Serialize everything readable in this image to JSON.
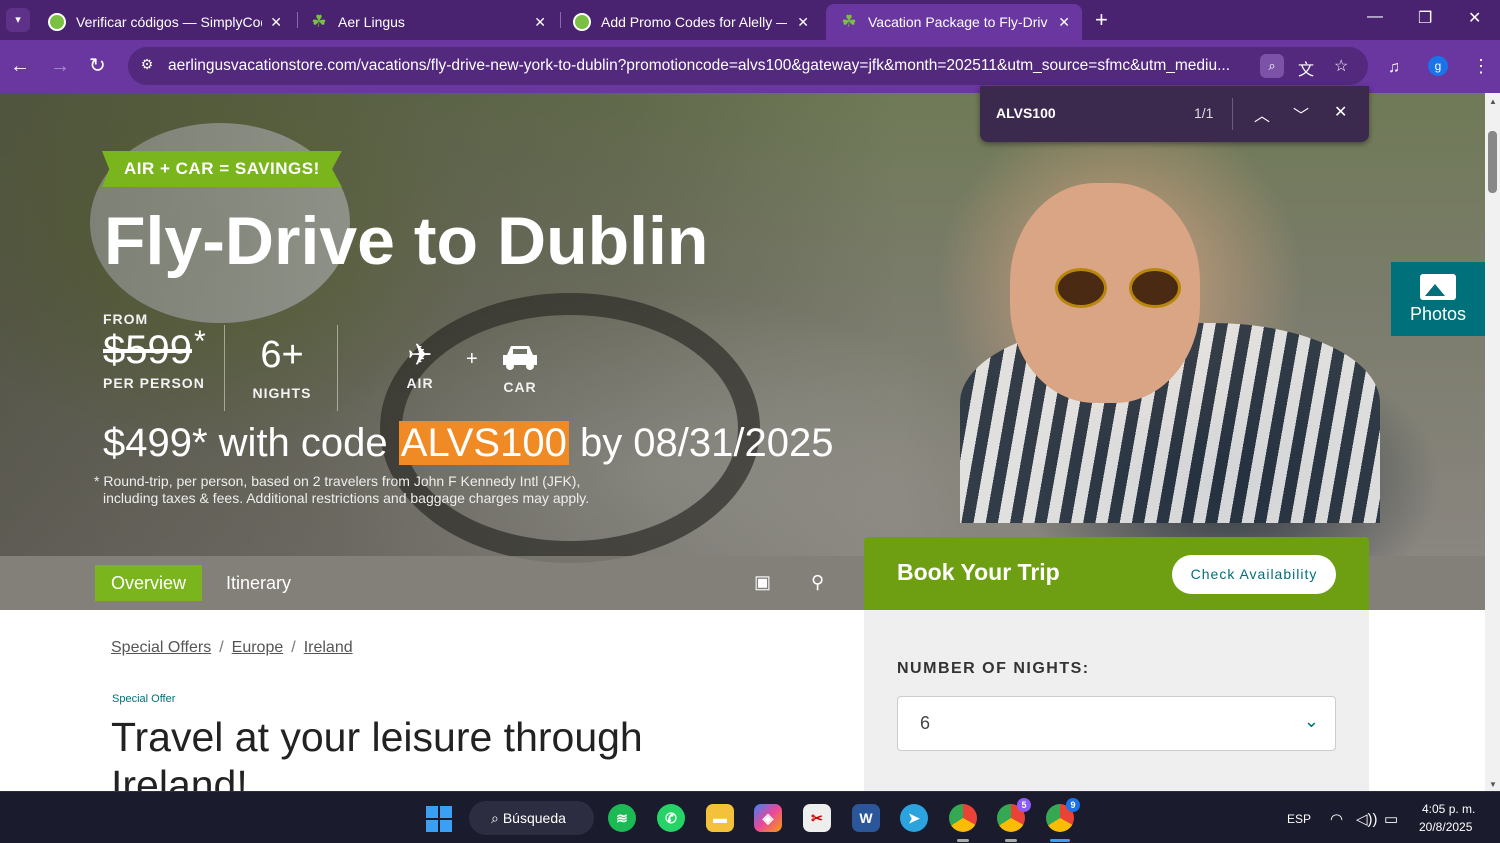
{
  "browser": {
    "tabs": [
      {
        "title": "Verificar códigos — SimplyCode",
        "active": false,
        "favicon": "simplycodes-icon"
      },
      {
        "title": "Aer Lingus",
        "active": false,
        "favicon": "shamrock-icon"
      },
      {
        "title": "Add Promo Codes for Alelly — Sim",
        "active": false,
        "favicon": "simplycodes-icon"
      },
      {
        "title": "Vacation Package to Fly-Drive: Dub",
        "active": true,
        "favicon": "shamrock-icon"
      }
    ],
    "url": "aerlingusvacationstore.com/vacations/fly-drive-new-york-to-dublin?promotioncode=alvs100&gateway=jfk&month=202511&utm_source=sfmc&utm_mediu...",
    "profile_initial": "g",
    "theme_color": "#6a36a0"
  },
  "find_bar": {
    "query": "ALVS100",
    "count": "1/1"
  },
  "hero": {
    "badge": "AIR + CAR = SAVINGS!",
    "title": "Fly-Drive to Dublin",
    "from_label": "FROM",
    "old_price": "$599",
    "asterisk": "*",
    "per_person": "PER PERSON",
    "nights_value": "6+",
    "nights_label": "NIGHTS",
    "air_label": "AIR",
    "plus": "+",
    "car_label": "CAR",
    "promo_prefix": "$499* with code ",
    "promo_code": "ALVS100",
    "promo_suffix": " by 08/31/2025",
    "fine_print_1": "* Round-trip, per person, based on 2 travelers from John F Kennedy Intl (JFK),",
    "fine_print_2": "including taxes & fees. Additional restrictions and baggage charges may apply.",
    "photos_label": "Photos"
  },
  "subnav": {
    "overview": "Overview",
    "itinerary": "Itinerary"
  },
  "booking": {
    "title": "Book Your Trip",
    "check_button": "Check Availability",
    "nights_label": "NUMBER OF NIGHTS:",
    "nights_value": "6"
  },
  "content": {
    "breadcrumb": [
      "Special Offers",
      "Europe",
      "Ireland"
    ],
    "breadcrumb_sep": "/",
    "special_offer": "Special Offer",
    "title": "Travel at your leisure through Ireland!"
  },
  "taskbar": {
    "search_label": "Búsqueda",
    "language": "ESP",
    "time": "4:05 p. m.",
    "date": "20/8/2025",
    "chrome_badge_1": "5",
    "chrome_badge_2": "9"
  },
  "colors": {
    "brand_green": "#7ab51d",
    "teal": "#00707a",
    "highlight": "#f08a24"
  }
}
